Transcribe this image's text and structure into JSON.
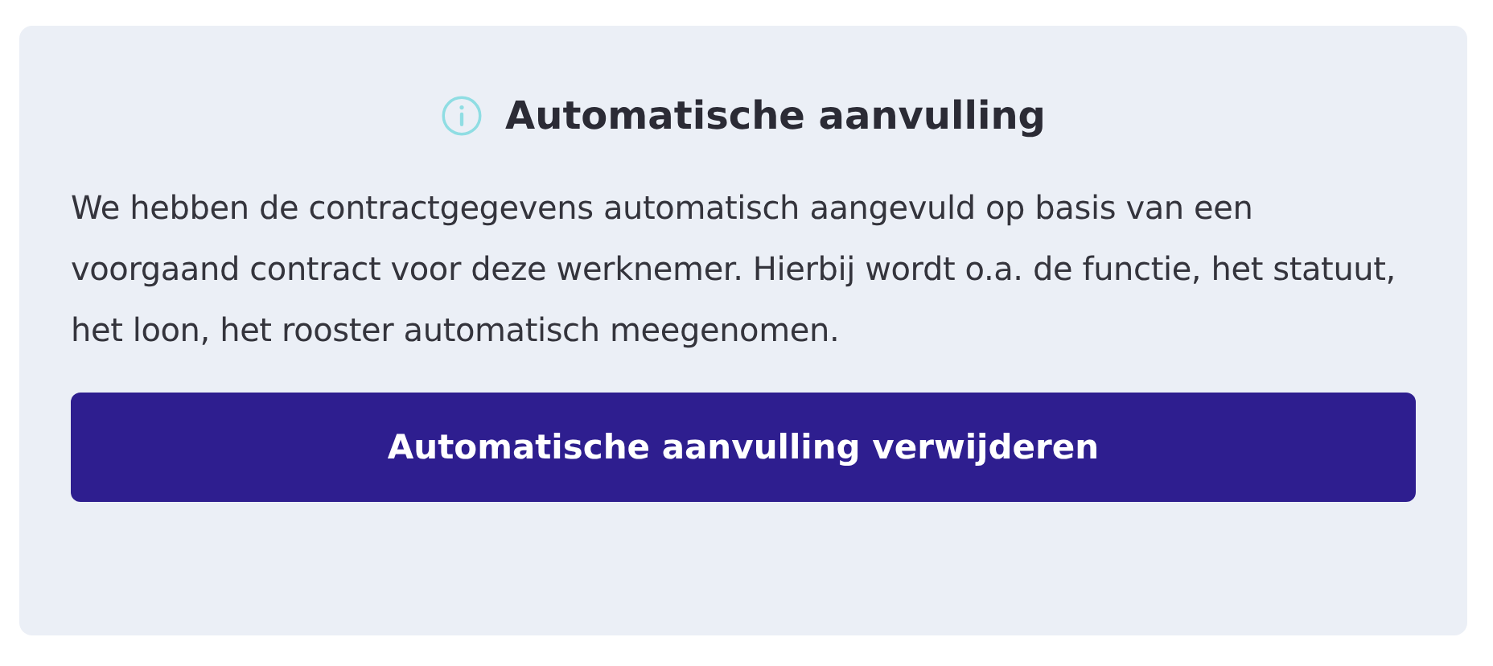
{
  "notice": {
    "title": "Automatische aanvulling",
    "message": "We hebben de contractgegevens automatisch aangevuld op basis van een voorgaand contract voor deze werknemer. Hierbij wordt o.a. de functie, het statuut, het loon, het rooster automatisch meegenomen.",
    "button": "Automatische aanvulling verwijderen"
  }
}
